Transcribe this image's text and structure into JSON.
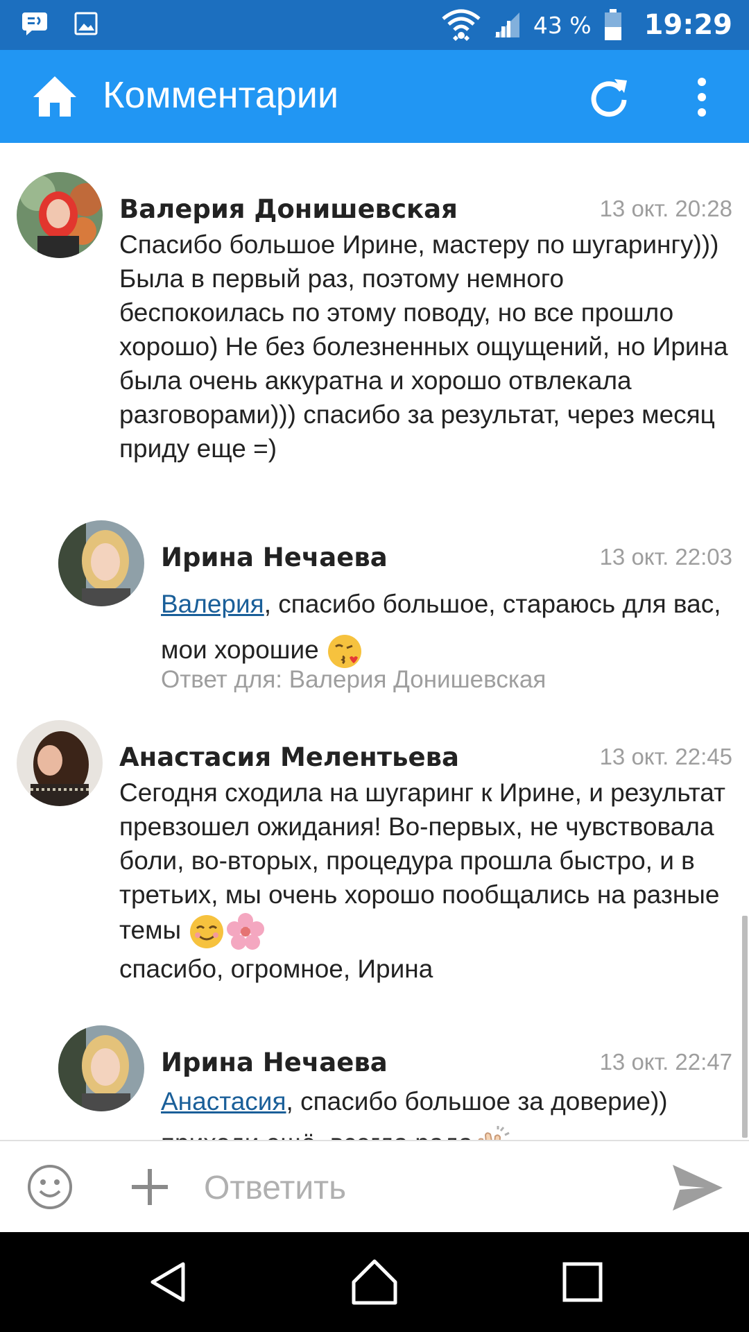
{
  "status_bar": {
    "battery_percent": "43 %",
    "time": "19:29",
    "icons": [
      "message-icon",
      "image-icon",
      "wifi-icon",
      "signal-icon",
      "battery-icon"
    ]
  },
  "app_bar": {
    "title": "Комментарии",
    "icons": [
      "home-icon",
      "refresh-icon",
      "more-vert-icon"
    ]
  },
  "comments": [
    {
      "author": "Валерия Донишевская",
      "time": "13 окт. 20:28",
      "text": "Спасибо большое Ирине, мастеру по шугарингу))) Была в первый раз, поэтому немного беспокоилась по этому поводу, но все прошло хорошо) Не без   болезненных ощущений, но Ирина была очень аккуратна и хорошо отвлекала разговорами))) спасибо за результат, через месяц приду еще =)"
    },
    {
      "author": "Ирина Нечаева",
      "time": "13 окт. 22:03",
      "mention": "Валерия",
      "text": ", спасибо большое, стараюсь для вас, мои хорошие",
      "emoji": "kiss-emoji",
      "reply_to": "Ответ для: Валерия Донишевская"
    },
    {
      "author": "Анастасия Мелентьева",
      "time": "13 окт. 22:45",
      "text_before_emoji": "Сегодня сходила на шугаринг к Ирине, и результат превзошел ожидания! Во-первых, не чувствовала боли, во-вторых, процедура прошла быстро, и в третьих, мы очень хорошо пообщались на разные темы",
      "emoji": [
        "smile-emoji",
        "blossom-emoji"
      ],
      "text_after_emoji": "спасибо, огромное, Ирина"
    },
    {
      "author": "Ирина Нечаева",
      "time": "13 окт. 22:47",
      "mention": "Анастасия",
      "text": ", спасибо большое за доверие))  приходи ещё, всегда рада",
      "emoji": "clapping-emoji"
    }
  ],
  "reply_bar": {
    "placeholder": "Ответить",
    "icons": [
      "smiley-icon",
      "plus-icon",
      "send-icon"
    ]
  },
  "nav_bar": {
    "icons": [
      "back-icon",
      "home-nav-icon",
      "recents-icon"
    ]
  },
  "colors": {
    "status_bar": "#1c6fbf",
    "app_bar": "#2196f3",
    "mention": "#1a5f99",
    "secondary_text": "#9e9e9e"
  }
}
